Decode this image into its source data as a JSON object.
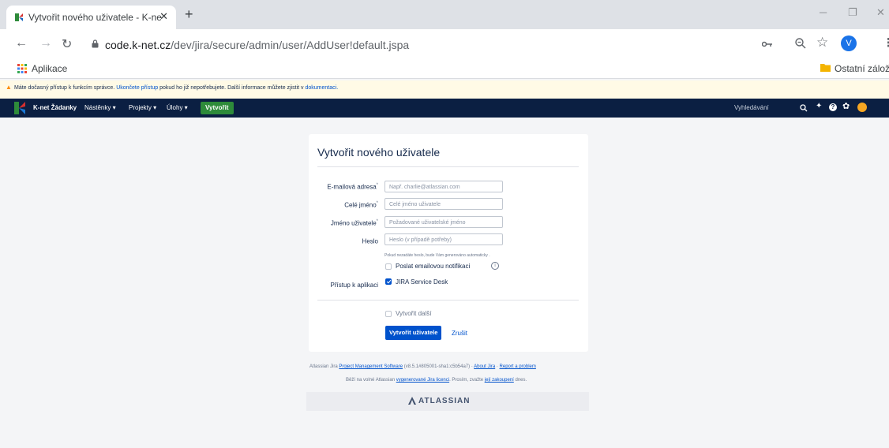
{
  "browser": {
    "tab_title": "Vytvořit nového uživatele - K-ne",
    "tab_close": "✕",
    "new_tab": "+",
    "url_host": "code.k-net.cz",
    "url_path": "/dev/jira/secure/admin/user/AddUser!default.jspa",
    "avatar_letter": "V",
    "bookmarks": {
      "apps_label": "Aplikace",
      "other_label": "Ostatní záložky"
    },
    "icons": {
      "back": "arrow-left-icon",
      "forward": "arrow-right-icon",
      "reload": "reload-icon",
      "lock": "lock-icon",
      "key": "key-icon",
      "zoom": "zoom-icon",
      "star": "star-icon",
      "menu": "kebab-menu-icon"
    }
  },
  "banner": {
    "text_before": "Máte dočasný přístup k funkcím správce.",
    "link1": "Ukončete přístup",
    "text_middle": "pokud ho již nepotřebujete. Další informace můžete zjistit v",
    "link2": "dokumentaci."
  },
  "jira": {
    "brand": "K-net Žádanky",
    "nav": [
      "Nástěnky ▾",
      "Projekty ▾",
      "Úlohy ▾"
    ],
    "create": "Vytvořit",
    "search_placeholder": "Vyhledávání"
  },
  "form": {
    "title": "Vytvořit nového uživatele",
    "fields": [
      {
        "label": "E-mailová adresa",
        "required": "*",
        "placeholder": "Např. charlie@atlassian.com"
      },
      {
        "label": "Celé jméno",
        "required": "*",
        "placeholder": "Celé jméno uživatele"
      },
      {
        "label": "Jméno uživatele",
        "required": "*",
        "placeholder": "Požadované uživatelské jméno"
      },
      {
        "label": "Heslo",
        "required": "",
        "placeholder": "Heslo (v případě potřeby)"
      }
    ],
    "password_hint": "Pokud nezadáte heslo, bude Vám generováno automaticky .",
    "send_notification": "Poslat emailovou notifikaci",
    "app_access_label": "Přístup k aplikaci",
    "app_access_option": "JIRA Service Desk",
    "create_another": "Vytvořit další",
    "submit": "Vytvořit uživatele",
    "cancel": "Zrušit"
  },
  "footer": {
    "line1_a": "Atlassian Jira",
    "line1_link1": "Project Management Software",
    "line1_b": "(v8.5.1#805001-sha1:c5b54a7)",
    "sep": "·",
    "line1_link2": "About Jira",
    "line1_link3": "Report a problem",
    "line2_a": "Běží na volné Atlassian",
    "line2_link1": "vygenerované Jira licenci",
    "line2_b": ". Prosím, zvažte",
    "line2_link2": "její zakoupení",
    "line2_c": "dnes.",
    "atlassian": "ATLASSIAN"
  },
  "colors": {
    "jira_header": "#0b1f42",
    "create_button": "#2e8b3a",
    "primary": "#0052cc",
    "banner_bg": "#fffae6"
  }
}
